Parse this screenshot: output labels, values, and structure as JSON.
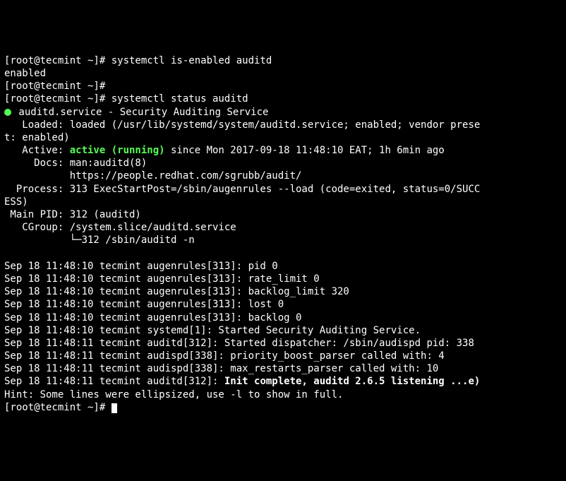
{
  "lines": [
    {
      "parts": [
        {
          "t": "[root@tecmint ~]# systemctl is-enabled auditd"
        }
      ]
    },
    {
      "parts": [
        {
          "t": "enabled"
        }
      ]
    },
    {
      "parts": [
        {
          "t": "[root@tecmint ~]# "
        }
      ]
    },
    {
      "parts": [
        {
          "t": "[root@tecmint ~]# systemctl status auditd"
        }
      ]
    },
    {
      "dot": true,
      "parts": [
        {
          "t": " auditd.service - Security Auditing Service"
        }
      ]
    },
    {
      "parts": [
        {
          "t": "   Loaded: loaded (/usr/lib/systemd/system/auditd.service; enabled; vendor prese"
        }
      ]
    },
    {
      "parts": [
        {
          "t": "t: enabled)"
        }
      ]
    },
    {
      "parts": [
        {
          "t": "   Active: "
        },
        {
          "t": "active (running)",
          "cls": "green bold"
        },
        {
          "t": " since Mon 2017-09-18 11:48:10 EAT; 1h 6min ago"
        }
      ]
    },
    {
      "parts": [
        {
          "t": "     Docs: man:auditd(8)"
        }
      ]
    },
    {
      "parts": [
        {
          "t": "           https://people.redhat.com/sgrubb/audit/"
        }
      ]
    },
    {
      "parts": [
        {
          "t": "  Process: 313 ExecStartPost=/sbin/augenrules --load (code=exited, status=0/SUCC"
        }
      ]
    },
    {
      "parts": [
        {
          "t": "ESS)"
        }
      ]
    },
    {
      "parts": [
        {
          "t": " Main PID: 312 (auditd)"
        }
      ]
    },
    {
      "parts": [
        {
          "t": "   CGroup: /system.slice/auditd.service"
        }
      ]
    },
    {
      "parts": [
        {
          "t": "           └─312 /sbin/auditd -n"
        }
      ]
    },
    {
      "parts": [
        {
          "t": " "
        }
      ]
    },
    {
      "parts": [
        {
          "t": "Sep 18 11:48:10 tecmint augenrules[313]: pid 0"
        }
      ]
    },
    {
      "parts": [
        {
          "t": "Sep 18 11:48:10 tecmint augenrules[313]: rate_limit 0"
        }
      ]
    },
    {
      "parts": [
        {
          "t": "Sep 18 11:48:10 tecmint augenrules[313]: backlog_limit 320"
        }
      ]
    },
    {
      "parts": [
        {
          "t": "Sep 18 11:48:10 tecmint augenrules[313]: lost 0"
        }
      ]
    },
    {
      "parts": [
        {
          "t": "Sep 18 11:48:10 tecmint augenrules[313]: backlog 0"
        }
      ]
    },
    {
      "parts": [
        {
          "t": "Sep 18 11:48:10 tecmint systemd[1]: Started Security Auditing Service."
        }
      ]
    },
    {
      "parts": [
        {
          "t": "Sep 18 11:48:11 tecmint auditd[312]: Started dispatcher: /sbin/audispd pid: 338"
        }
      ]
    },
    {
      "parts": [
        {
          "t": "Sep 18 11:48:11 tecmint audispd[338]: priority_boost_parser called with: 4"
        }
      ]
    },
    {
      "parts": [
        {
          "t": "Sep 18 11:48:11 tecmint audispd[338]: max_restarts_parser called with: 10"
        }
      ]
    },
    {
      "parts": [
        {
          "t": "Sep 18 11:48:11 tecmint auditd[312]: "
        },
        {
          "t": "Init complete, auditd 2.6.5 listening ...e)",
          "cls": "bold"
        }
      ]
    },
    {
      "parts": [
        {
          "t": "Hint: Some lines were ellipsized, use -l to show in full."
        }
      ]
    },
    {
      "parts": [
        {
          "t": "[root@tecmint ~]# "
        }
      ],
      "cursor": true
    }
  ]
}
